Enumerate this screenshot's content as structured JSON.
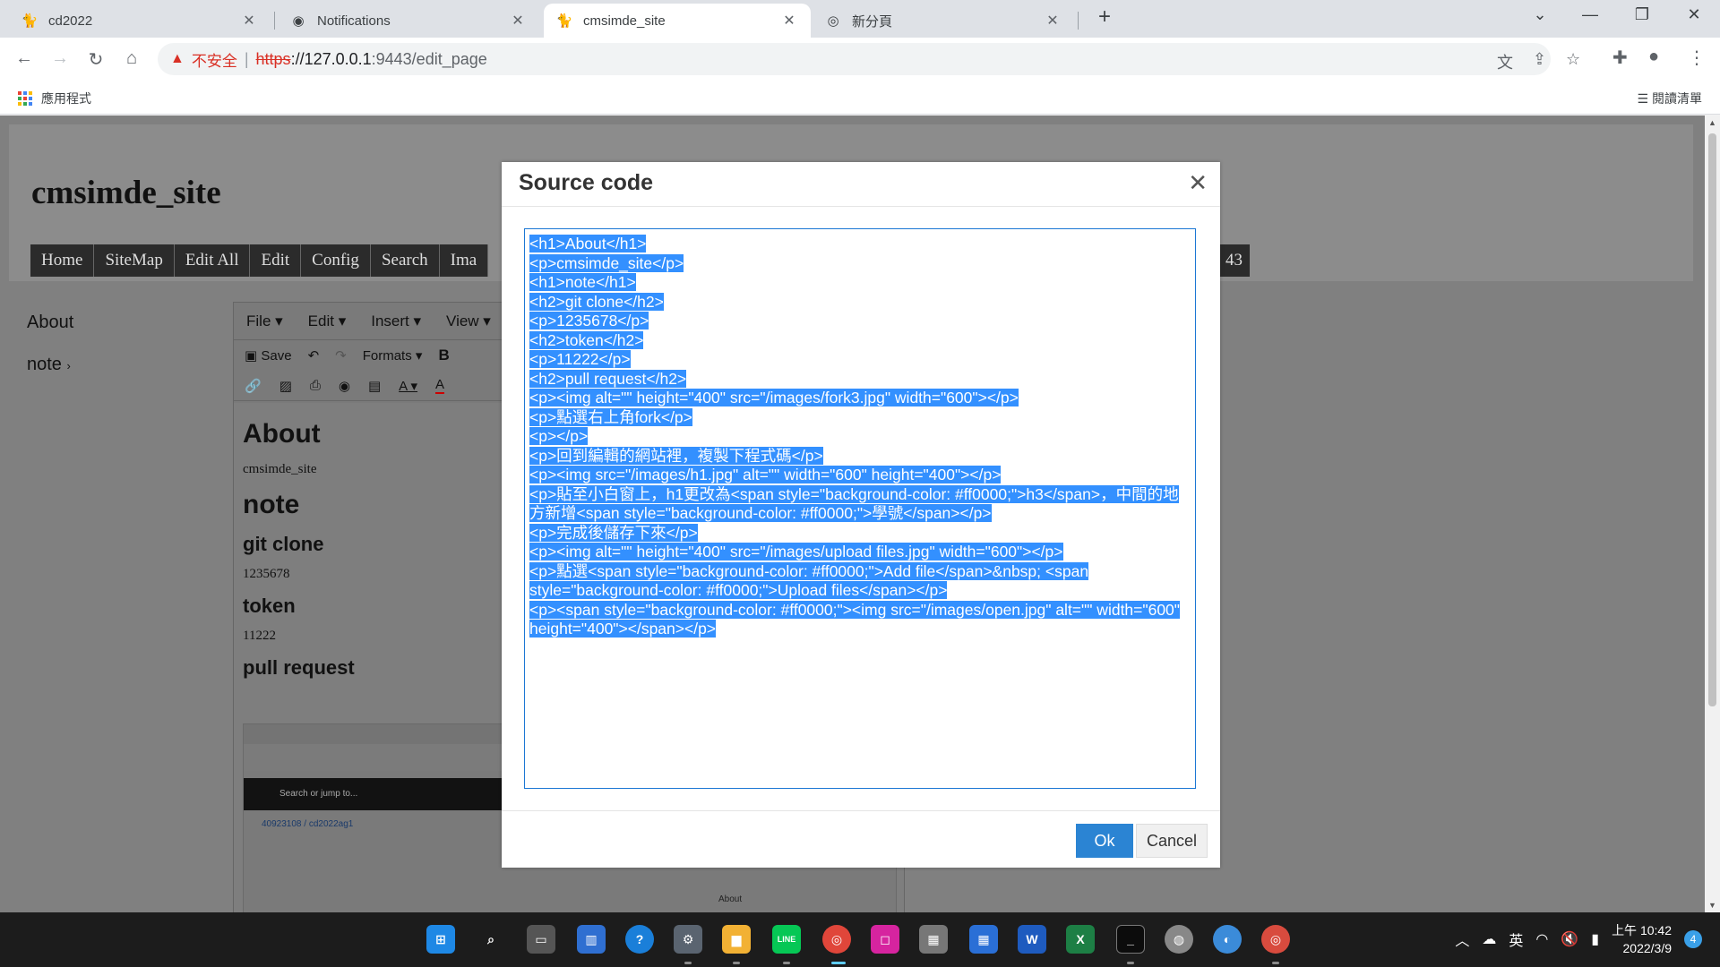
{
  "browser": {
    "tabs": [
      {
        "title": "cd2022",
        "icon": "cat-icon"
      },
      {
        "title": "Notifications",
        "icon": "github-icon"
      },
      {
        "title": "cmsimde_site",
        "icon": "cat-icon",
        "active": true
      },
      {
        "title": "新分頁",
        "icon": "chrome-icon"
      }
    ],
    "address": {
      "warning_text": "不安全",
      "scheme": "https",
      "host": "://127.0.0.1",
      "path": ":9443/edit_page"
    },
    "bookmarks": {
      "apps_label": "應用程式",
      "reading_list_label": "閱讀清單"
    }
  },
  "site": {
    "title": "cmsimde_site",
    "menu": [
      "Home",
      "SiteMap",
      "Edit All",
      "Edit",
      "Config",
      "Search",
      "Ima"
    ],
    "menu_tail": "43",
    "sidebar": [
      "About",
      "note"
    ]
  },
  "editor": {
    "menubar": [
      "File",
      "Edit",
      "Insert",
      "View"
    ],
    "save_label": "Save",
    "formats_label": "Formats",
    "bold_label": "B",
    "content": {
      "h1_about": "About",
      "p_site": "cmsimde_site",
      "h1_note": "note",
      "h2_git": "git clone",
      "p_num": "1235678",
      "h2_token": "token",
      "p_token": "11222",
      "h2_pull": "pull request"
    },
    "embedded": {
      "repo": "40923108 / cd2022ag1",
      "search": "Search or jump to...",
      "about": "About"
    }
  },
  "modal": {
    "title": "Source code",
    "lines": [
      "<h1>About</h1>",
      "<p>cmsimde_site</p>",
      "<h1>note</h1>",
      "<h2>git clone</h2>",
      "<p>1235678</p>",
      "<h2>token</h2>",
      "<p>11222</p>",
      "<h2>pull request</h2>",
      "<p><img alt=\"\" height=\"400\" src=\"/images/fork3.jpg\" width=\"600\"></p>",
      "<p>點選右上角fork</p>",
      "<p></p>",
      "<p>回到編輯的網站裡，複製下程式碼</p>",
      "<p><img src=\"/images/h1.jpg\" alt=\"\" width=\"600\" height=\"400\"></p>",
      "<p>貼至小白窗上，h1更改為<span style=\"background-color: #ff0000;\">h3</span>，中間的地",
      "方新增<span style=\"background-color: #ff0000;\">學號</span></p>",
      "<p>完成後儲存下來</p>",
      "<p><img alt=\"\" height=\"400\" src=\"/images/upload files.jpg\" width=\"600\"></p>",
      "<p>點選<span style=\"background-color: #ff0000;\">Add file</span>&nbsp; <span",
      "style=\"background-color: #ff0000;\">Upload files</span></p>",
      "<p><span style=\"background-color: #ff0000;\"><img src=\"/images/open.jpg\" alt=\"\" width=\"600\"",
      "height=\"400\"></span></p>"
    ],
    "ok_label": "Ok",
    "cancel_label": "Cancel"
  },
  "taskbar": {
    "ime": "英",
    "time": "上午 10:42",
    "date": "2022/3/9",
    "notifications": "4"
  },
  "colors": {
    "selection": "#3390ff",
    "ok_button": "#2b84d3",
    "overlay": "#808080"
  }
}
